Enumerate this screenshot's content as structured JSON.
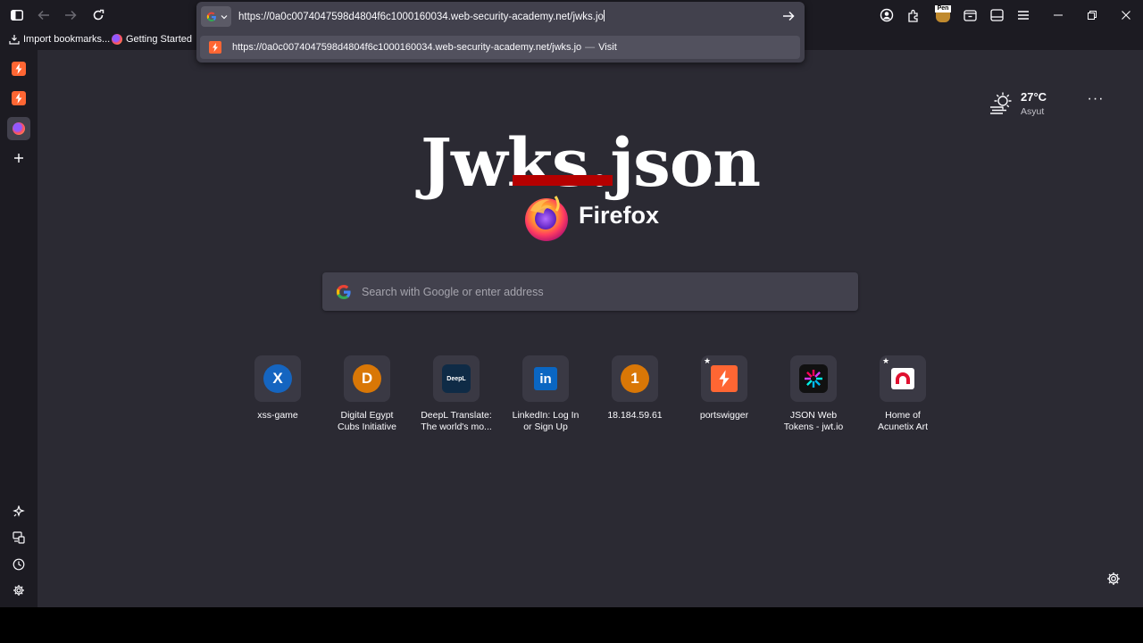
{
  "browser": {
    "address_bar": {
      "url": "https://0a0c0074047598d4804f6c1000160034.web-security-academy.net/jwks.jo",
      "suggestion": {
        "url": "https://0a0c0074047598d4804f6c1000160034.web-security-academy.net/jwks.jo",
        "separator": "—",
        "action": "Visit"
      }
    },
    "bookmarks": [
      {
        "label": "Import bookmarks...",
        "icon": "import-icon"
      },
      {
        "label": "Getting Started",
        "icon": "firefox-icon"
      }
    ],
    "toolbar_right_badge": "Pen"
  },
  "overlay_title": "Jwks.json",
  "brand": {
    "wordmark": "Firefox"
  },
  "search": {
    "placeholder": "Search with Google or enter address"
  },
  "weather": {
    "temperature": "27°C",
    "location": "Asyut"
  },
  "shortcuts": [
    {
      "label_line1": "xss-game",
      "label_line2": "",
      "icon_text": "X",
      "icon_bg": "#1565c0",
      "pinned": false
    },
    {
      "label_line1": "Digital Egypt",
      "label_line2": "Cubs Initiative",
      "icon_text": "D",
      "icon_bg": "#d97706",
      "pinned": false
    },
    {
      "label_line1": "DeepL Translate:",
      "label_line2": "The world's mo...",
      "icon_text": "DeepL",
      "icon_bg": "#0f2b46",
      "pinned": false
    },
    {
      "label_line1": "LinkedIn: Log In",
      "label_line2": "or Sign Up",
      "icon_text": "in",
      "icon_bg": "#0a66c2",
      "pinned": false
    },
    {
      "label_line1": "18.184.59.61",
      "label_line2": "",
      "icon_text": "1",
      "icon_bg": "#d97706",
      "pinned": false
    },
    {
      "label_line1": "portswigger",
      "label_line2": "",
      "icon_text": "",
      "icon_bg": "#ff6633",
      "pinned": true
    },
    {
      "label_line1": "JSON Web",
      "label_line2": "Tokens - jwt.io",
      "icon_text": "",
      "icon_bg": "#111111",
      "pinned": false
    },
    {
      "label_line1": "Home of",
      "label_line2": "Acunetix Art",
      "icon_text": "",
      "icon_bg": "#ffffff",
      "pinned": true
    }
  ],
  "colors": {
    "accent_red": "#b50000",
    "page_bg": "#2b2a33",
    "chrome_bg": "#1c1b22"
  }
}
